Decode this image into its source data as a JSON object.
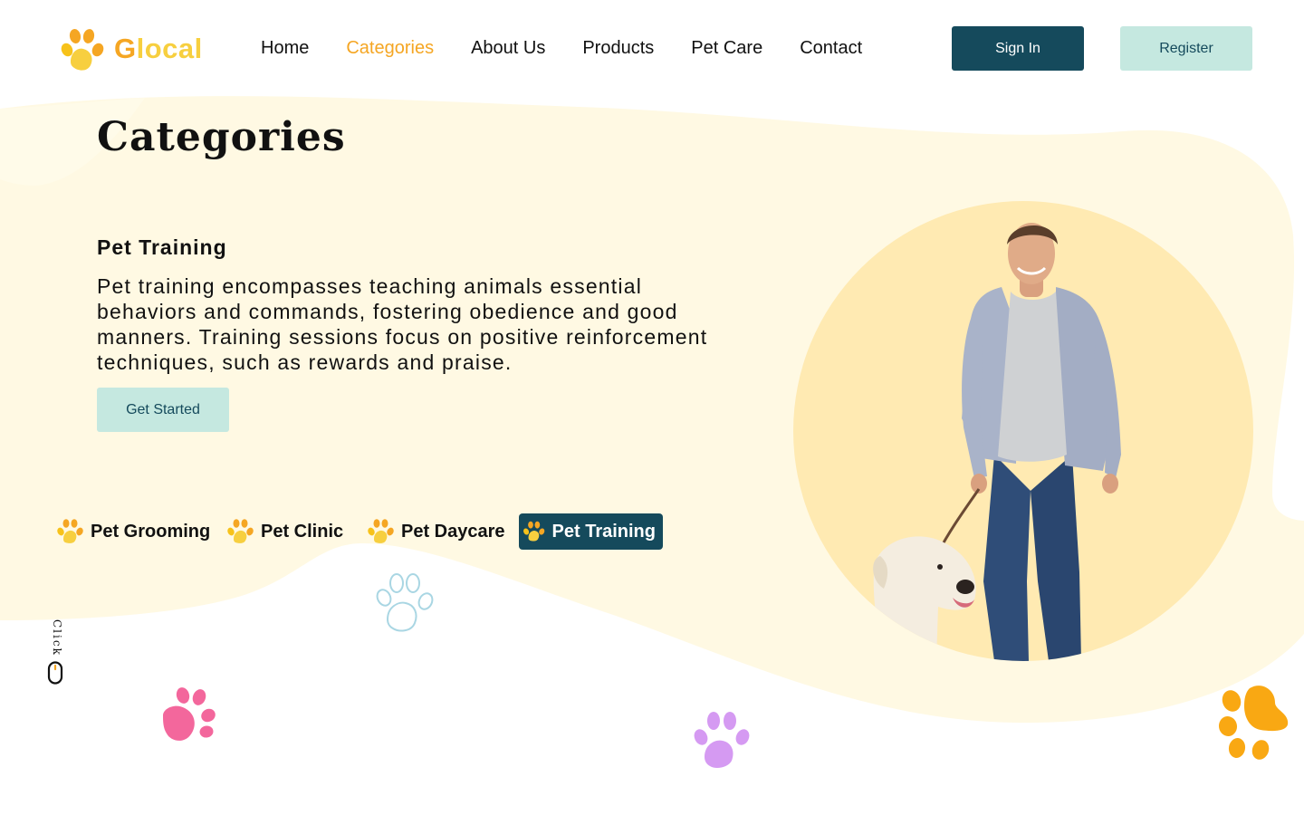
{
  "brand": {
    "first_letter": "G",
    "rest": "local",
    "accent": "#f5a623",
    "accent_light": "#f7cf3f"
  },
  "nav": {
    "items": [
      {
        "label": "Home"
      },
      {
        "label": "Categories"
      },
      {
        "label": "About Us"
      },
      {
        "label": "Products"
      },
      {
        "label": "Pet Care"
      },
      {
        "label": "Contact"
      }
    ],
    "active": "Categories"
  },
  "auth": {
    "signin_label": "Sign In",
    "register_label": "Register"
  },
  "main": {
    "title": "Categories",
    "section_title": "Pet Training",
    "section_desc": "Pet training encompasses teaching animals essential behaviors and commands, fostering obedience and good manners. Training sessions focus on positive reinforcement techniques, such as rewards and praise.",
    "cta_label": "Get Started"
  },
  "tabs": [
    {
      "label": "Pet Grooming",
      "active": false
    },
    {
      "label": "Pet Clinic",
      "active": false
    },
    {
      "label": "Pet Daycare",
      "active": false
    },
    {
      "label": "Pet Training",
      "active": true
    }
  ],
  "scroll_hint": {
    "label": "Click"
  },
  "icons": [
    "paw-logo-icon",
    "paw-icon",
    "mouse-icon"
  ],
  "colors": {
    "primary_dark": "#154a5c",
    "mint": "#c5e8e0",
    "cream_bg": "#fff9e3",
    "hero_circle": "#ffeab2",
    "paw_pink": "#f3679c",
    "paw_purple": "#d59af2",
    "paw_orange": "#f9a813",
    "paw_outline_blue": "#a9d6e3"
  }
}
